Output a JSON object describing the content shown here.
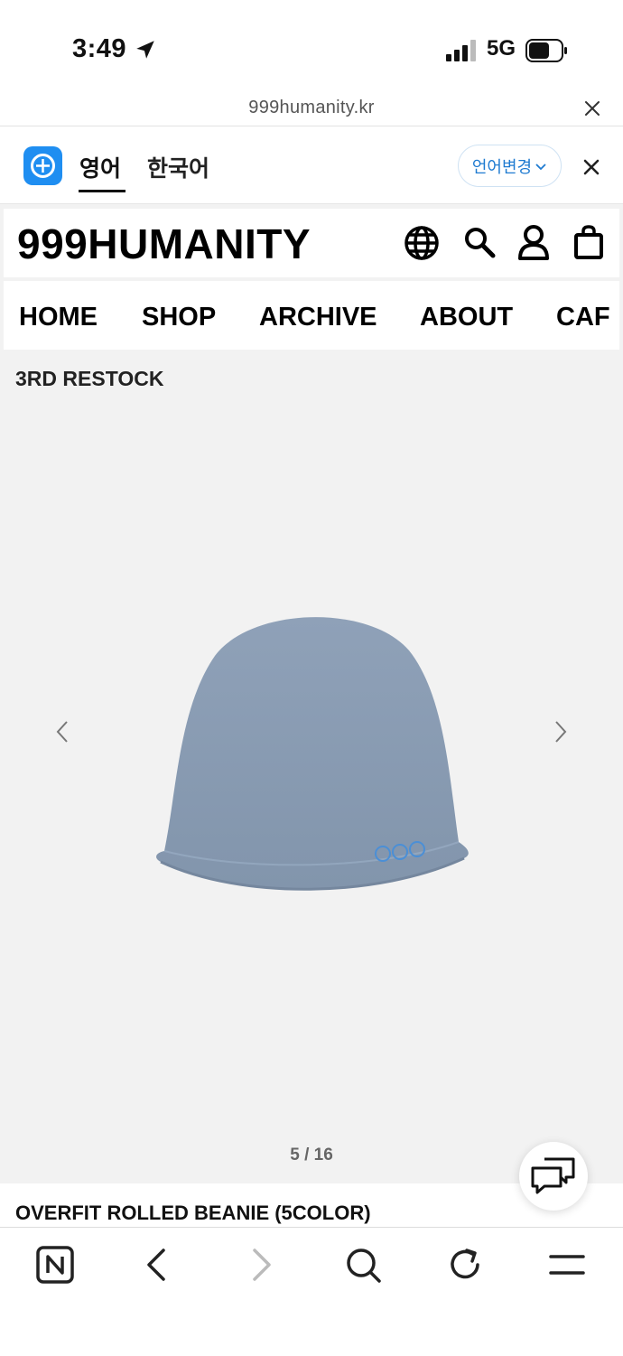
{
  "status_bar": {
    "time": "3:49",
    "network": "5G",
    "icons": [
      "location-arrow-icon",
      "signal-icon",
      "battery-icon"
    ]
  },
  "browser": {
    "url": "999humanity.kr",
    "toolbar_icons": [
      "naver-home-icon",
      "back-icon",
      "forward-icon",
      "search-icon",
      "reload-icon",
      "menu-icon"
    ]
  },
  "translate_bar": {
    "lang_source": "영어",
    "lang_target": "한국어",
    "change_label": "언어변경"
  },
  "site": {
    "brand": "999HUMANITY",
    "nav": [
      "HOME",
      "SHOP",
      "ARCHIVE",
      "ABOUT",
      "CAF"
    ],
    "header_icons": [
      "globe-icon",
      "search-icon",
      "account-icon",
      "bag-icon"
    ]
  },
  "product": {
    "section_title": "3RD RESTOCK",
    "slide_counter": "5 / 16",
    "title": "OVERFIT ROLLED BEANIE (5COLOR)",
    "image_color": "#8a9bb2"
  },
  "colors": {
    "accent": "#1f8ef1",
    "page_bg": "#f2f2f2"
  }
}
